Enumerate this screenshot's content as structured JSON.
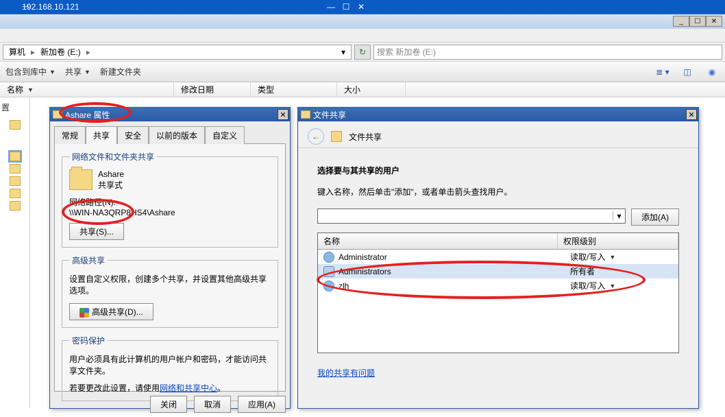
{
  "rdp": {
    "host": "192.168.10.121"
  },
  "explorer": {
    "breadcrumb_parent": "算机",
    "breadcrumb_current": "新加卷 (E:)",
    "search_placeholder": "搜索 新加卷 (E:)",
    "cmd_organize": "包含到库中",
    "cmd_share": "共享",
    "cmd_new": "新建文件夹",
    "col_name": "名称",
    "col_date": "修改日期",
    "col_type": "类型",
    "col_size": "大小",
    "nav_label": "置"
  },
  "props": {
    "title": "Ashare 属性",
    "tabs": {
      "general": "常规",
      "share": "共享",
      "security": "安全",
      "prev": "以前的版本",
      "custom": "自定义"
    },
    "gb1": {
      "legend": "网络文件和文件夹共享",
      "name": "Ashare",
      "state": "共享式",
      "path_label": "网络路径(N):",
      "path_value": "\\\\WIN-NA3QRP8HS4\\Ashare",
      "btn": "共享(S)..."
    },
    "gb2": {
      "legend": "高级共享",
      "desc": "设置自定义权限，创建多个共享，并设置其他高级共享选项。",
      "btn": "高级共享(D)..."
    },
    "gb3": {
      "legend": "密码保护",
      "desc": "用户必须具有此计算机的用户帐户和密码，才能访问共享文件夹。",
      "prefix": "若要更改此设置，请使用",
      "link": "网络和共享中心",
      "suffix": "。"
    },
    "btns": {
      "close": "关闭",
      "cancel": "取消",
      "apply": "应用(A)"
    }
  },
  "fs": {
    "title": "文件共享",
    "header": "文件共享",
    "h1": "选择要与其共享的用户",
    "h2": "键入名称，然后单击\"添加\"，或者单击箭头查找用户。",
    "add_btn": "添加(A)",
    "col_name": "名称",
    "col_level": "权限级别",
    "rows": [
      {
        "name": "Administrator",
        "level": "读取/写入",
        "dd": true
      },
      {
        "name": "Administrators",
        "level": "所有者",
        "dd": false,
        "multi": true,
        "sel": true
      },
      {
        "name": "zlh",
        "level": "读取/写入",
        "dd": true
      }
    ],
    "help_link": "我的共享有问题"
  }
}
